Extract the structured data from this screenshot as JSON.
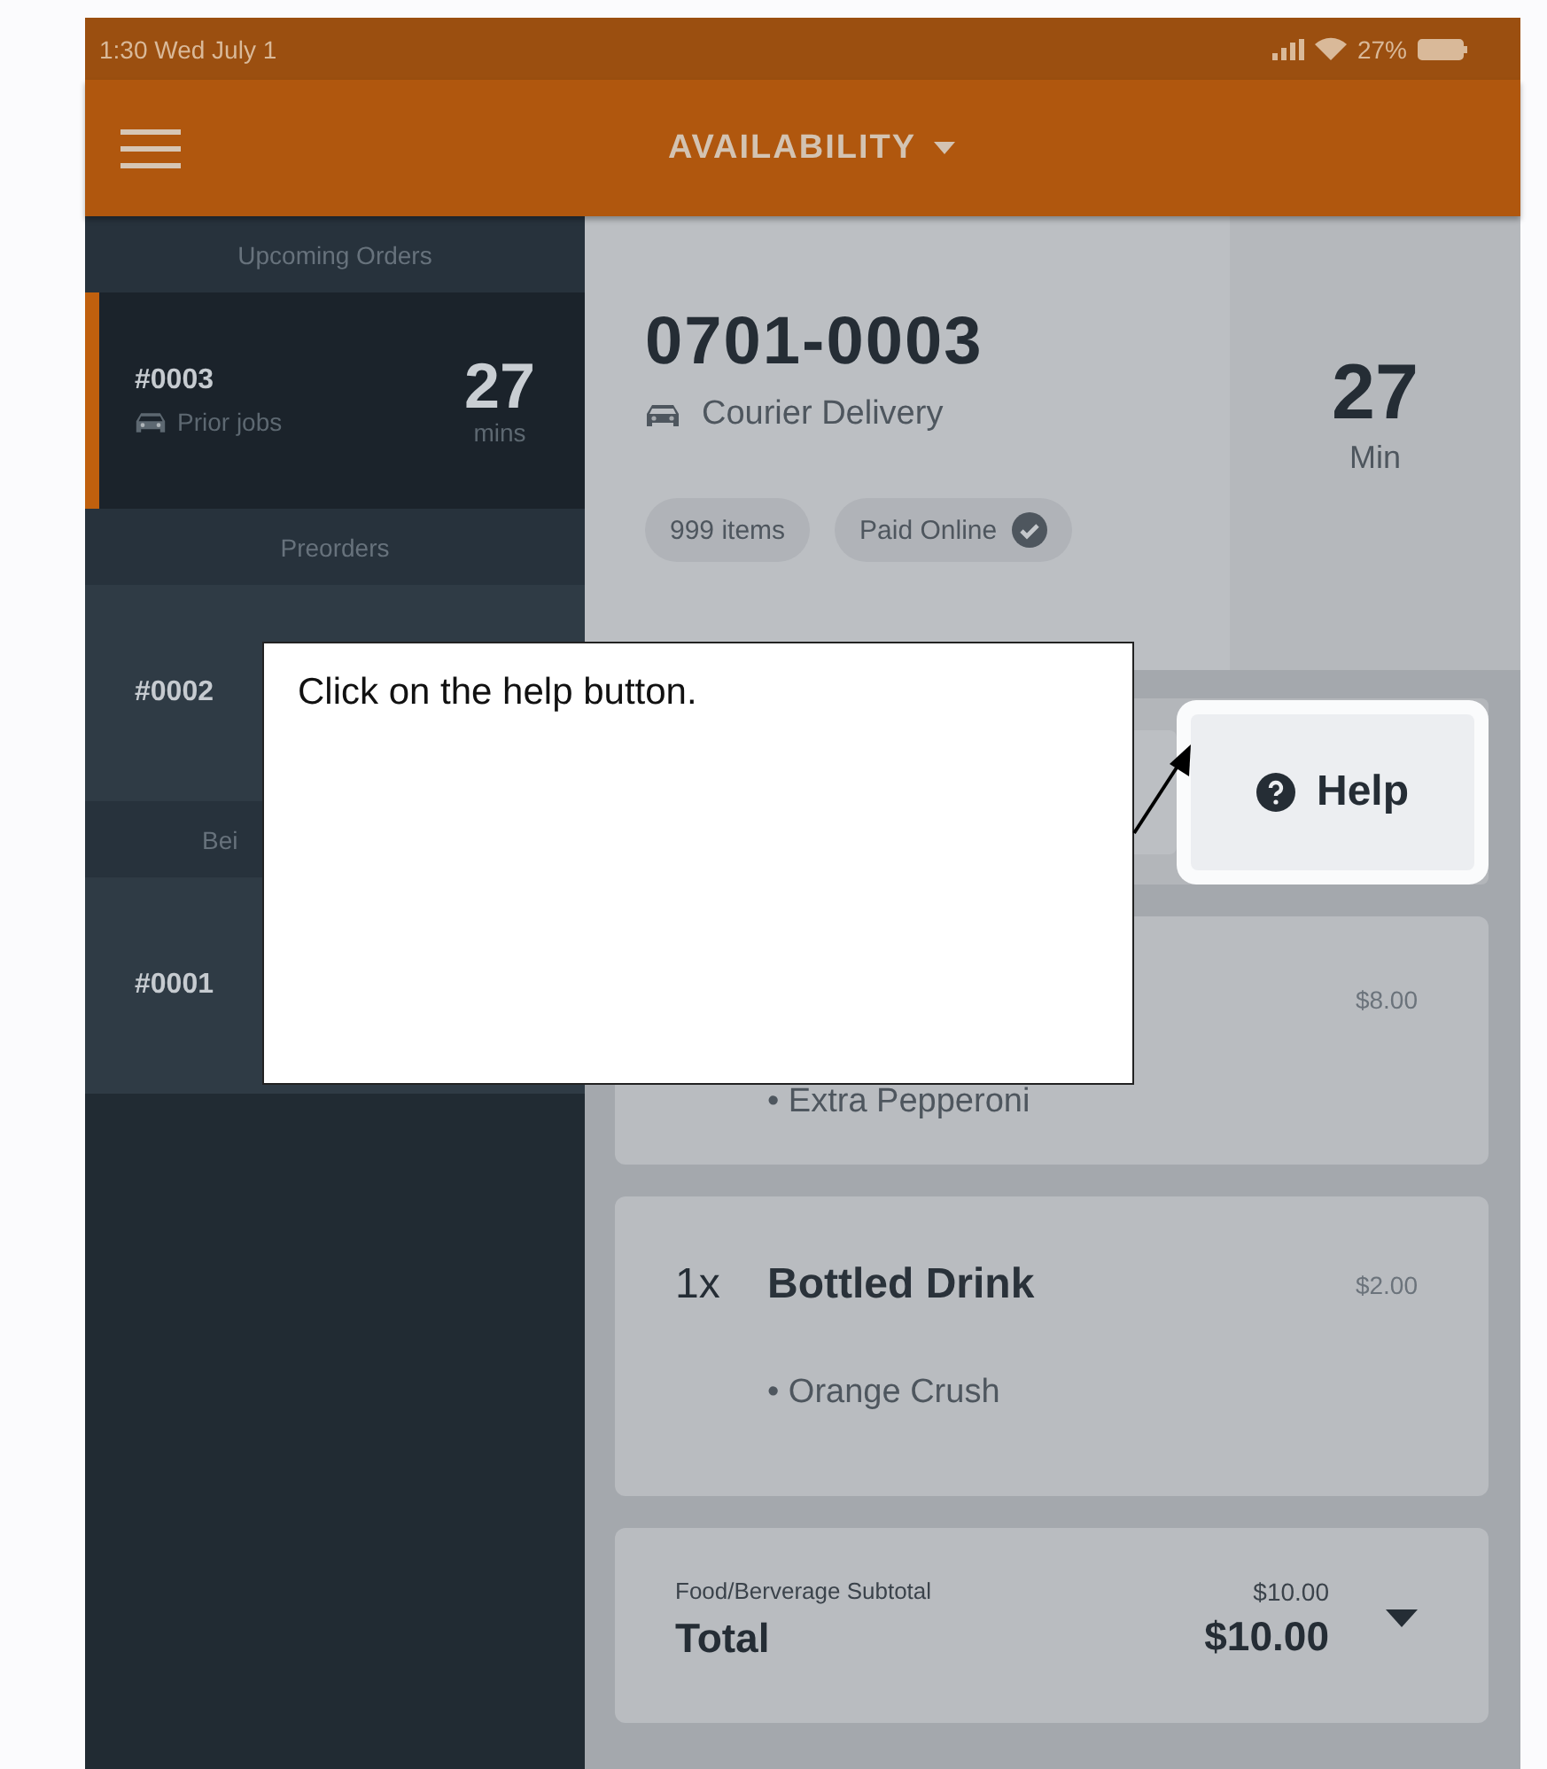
{
  "status_bar": {
    "time": "1:30 Wed July 1",
    "battery": "27%"
  },
  "nav": {
    "title": "AVAILABILITY"
  },
  "sidebar": {
    "sections": [
      {
        "header": "Upcoming Orders",
        "orders": [
          {
            "number": "#0003",
            "type": "Prior jobs",
            "minutes": "27",
            "unit": "mins",
            "selected": true
          }
        ]
      },
      {
        "header": "Preorders",
        "orders": [
          {
            "number": "#0002",
            "selected": false
          }
        ]
      },
      {
        "header": "Bei",
        "cut": true,
        "orders": [
          {
            "number": "#0001",
            "selected": false
          }
        ]
      }
    ]
  },
  "order": {
    "number": "0701-0003",
    "type": "Courier Delivery",
    "chips": [
      {
        "label": "999 items",
        "checked": false
      },
      {
        "label": "Paid Online",
        "checked": true
      }
    ],
    "time": "27",
    "time_unit": "Min"
  },
  "toolbar": {
    "help": "Help",
    "highlighted": true
  },
  "items": [
    {
      "price": "$8.00",
      "modifiers": [
        "• Extra Pepperoni"
      ]
    },
    {
      "qty": "1x",
      "name": "Bottled Drink",
      "price": "$2.00",
      "modifiers": [
        "• Orange Crush"
      ]
    }
  ],
  "totals": {
    "subtotal_label": "Food/Berverage Subtotal",
    "subtotal": "$10.00",
    "total_label": "Total",
    "total": "$10.00"
  },
  "callout": {
    "text": "Click on the help button."
  }
}
